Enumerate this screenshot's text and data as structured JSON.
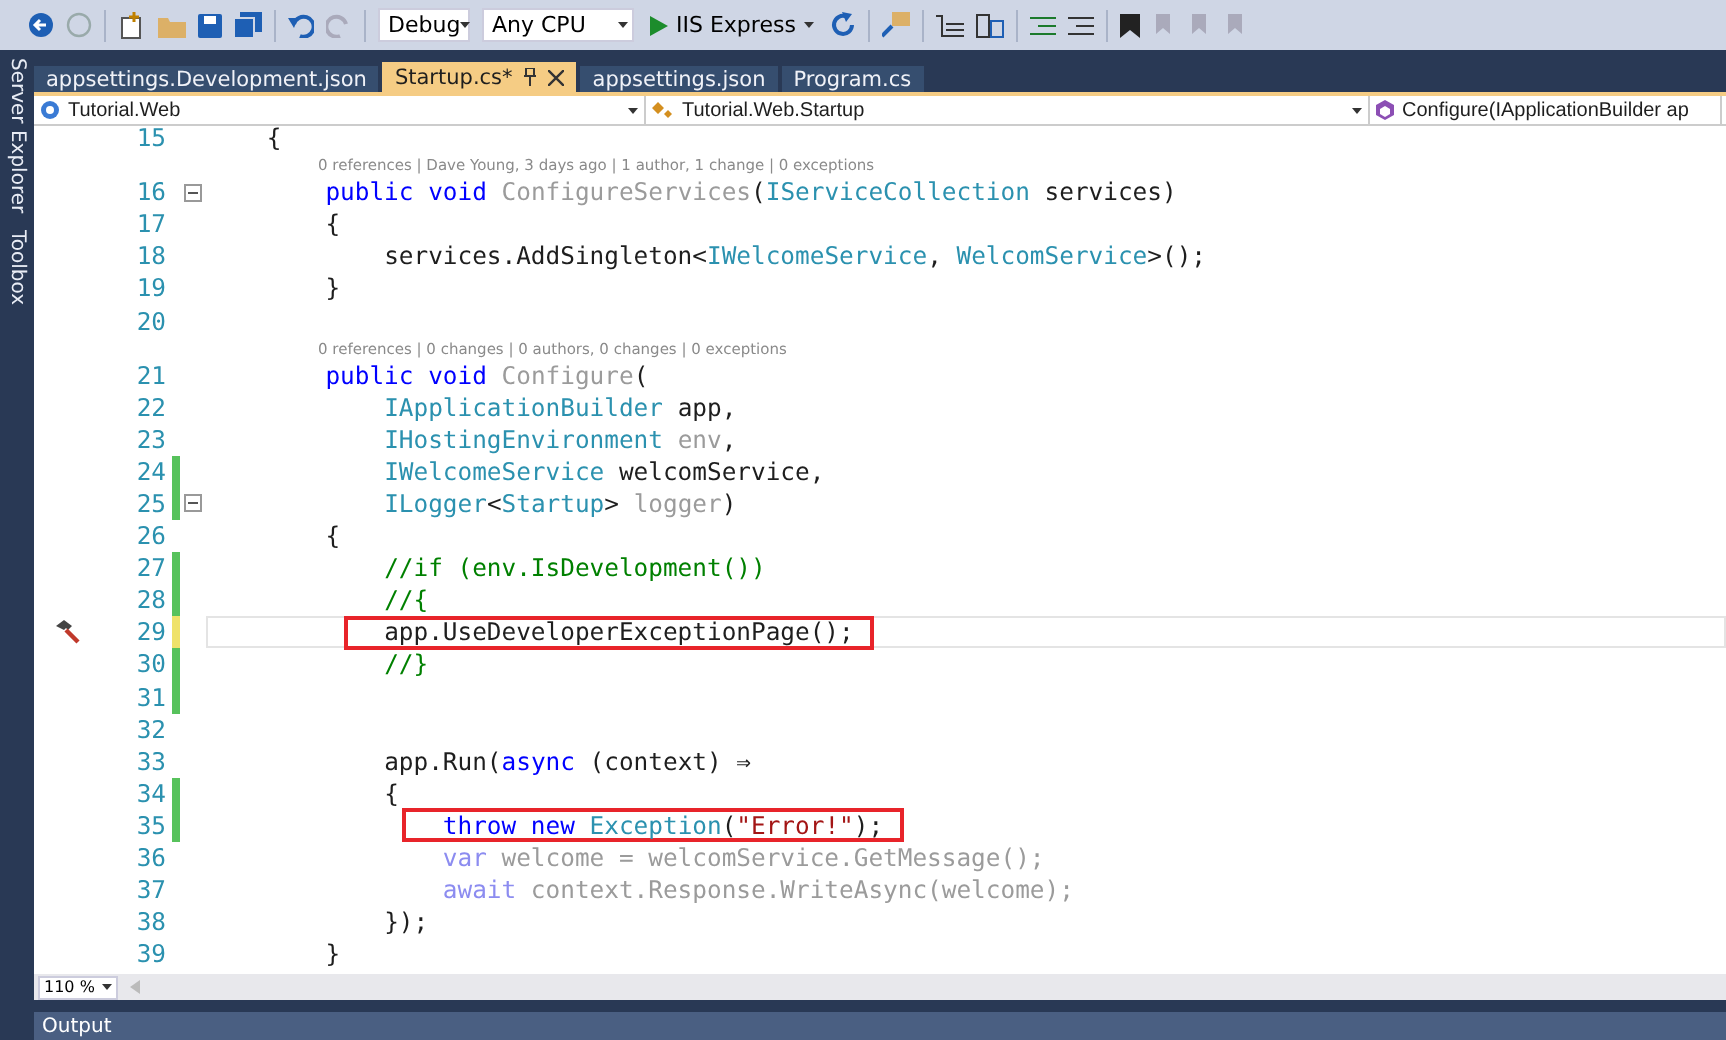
{
  "toolbar": {
    "configuration": "Debug",
    "platform": "Any CPU",
    "run_target": "IIS Express"
  },
  "side_tabs": [
    "Server Explorer",
    "Toolbox"
  ],
  "tabs": [
    {
      "label": "appsettings.Development.json",
      "selected": false
    },
    {
      "label": "Startup.cs*",
      "selected": true
    },
    {
      "label": "appsettings.json",
      "selected": false
    },
    {
      "label": "Program.cs",
      "selected": false
    }
  ],
  "nav": {
    "project": "Tutorial.Web",
    "type": "Tutorial.Web.Startup",
    "member": "Configure(IApplicationBuilder ap"
  },
  "editor": {
    "lines": [
      {
        "number": "15",
        "tokens": [
          {
            "kind": "plain",
            "text": "    {"
          }
        ]
      },
      {
        "codelens": "0 references | Dave Young, 3 days ago | 1 author, 1 change | 0 exceptions",
        "number": "16",
        "fold": true,
        "tokens": [
          {
            "kind": "keyword",
            "text": "        public void "
          },
          {
            "kind": "dim",
            "text": "ConfigureServices"
          },
          {
            "kind": "plain",
            "text": "("
          },
          {
            "kind": "type",
            "text": "IServiceCollection"
          },
          {
            "kind": "plain",
            "text": " services)"
          }
        ]
      },
      {
        "number": "17",
        "tokens": [
          {
            "kind": "plain",
            "text": "        {"
          }
        ]
      },
      {
        "number": "18",
        "tokens": [
          {
            "kind": "plain",
            "text": "            services.AddSingleton<"
          },
          {
            "kind": "type",
            "text": "IWelcomeService"
          },
          {
            "kind": "plain",
            "text": ", "
          },
          {
            "kind": "type",
            "text": "WelcomService"
          },
          {
            "kind": "plain",
            "text": ">();"
          }
        ]
      },
      {
        "number": "19",
        "tokens": [
          {
            "kind": "plain",
            "text": "        }"
          }
        ]
      },
      {
        "number": "20"
      },
      {
        "codelens": "0 references | 0 changes | 0 authors, 0 changes | 0 exceptions",
        "number": "21",
        "tokens": [
          {
            "kind": "keyword",
            "text": "        public void "
          },
          {
            "kind": "dim",
            "text": "Configure"
          },
          {
            "kind": "plain",
            "text": "("
          }
        ]
      },
      {
        "number": "22",
        "tokens": [
          {
            "kind": "type",
            "text": "            IApplicationBuilder"
          },
          {
            "kind": "plain",
            "text": " app,"
          }
        ]
      },
      {
        "number": "23",
        "tokens": [
          {
            "kind": "type",
            "text": "            IHostingEnvironment"
          },
          {
            "kind": "dim",
            "text": " env"
          },
          {
            "kind": "plain",
            "text": ","
          }
        ]
      },
      {
        "number": "24",
        "modified": true,
        "saved": true,
        "tokens": [
          {
            "kind": "type",
            "text": "            IWelcomeService"
          },
          {
            "kind": "plain",
            "text": " welcomService,"
          }
        ]
      },
      {
        "number": "25",
        "modified": true,
        "saved": true,
        "fold": true,
        "tokens": [
          {
            "kind": "type",
            "text": "            ILogger"
          },
          {
            "kind": "plain",
            "text": "<"
          },
          {
            "kind": "type",
            "text": "Startup"
          },
          {
            "kind": "plain",
            "text": ">"
          },
          {
            "kind": "dim",
            "text": " logger"
          },
          {
            "kind": "plain",
            "text": ")"
          }
        ]
      },
      {
        "number": "26",
        "tokens": [
          {
            "kind": "plain",
            "text": "        {"
          }
        ]
      },
      {
        "number": "27",
        "modified": true,
        "saved": true,
        "tokens": [
          {
            "kind": "comment",
            "text": "            //if (env.IsDevelopment())"
          }
        ]
      },
      {
        "number": "28",
        "modified": true,
        "saved": true,
        "tokens": [
          {
            "kind": "comment",
            "text": "            //{"
          }
        ]
      },
      {
        "number": "29",
        "modified": true,
        "saved": false,
        "current": true,
        "quick_action": true,
        "boxed": true,
        "tokens": [
          {
            "kind": "plain",
            "text": "            app.UseDeveloperExceptionPage();"
          }
        ]
      },
      {
        "number": "30",
        "modified": true,
        "saved": true,
        "tokens": [
          {
            "kind": "comment",
            "text": "            //}"
          }
        ]
      },
      {
        "number": "31",
        "modified": true,
        "saved": true
      },
      {
        "number": "32"
      },
      {
        "number": "33",
        "tokens": [
          {
            "kind": "plain",
            "text": "            app.Run("
          },
          {
            "kind": "keyword",
            "text": "async"
          },
          {
            "kind": "plain",
            "text": " (context) ⇒"
          }
        ]
      },
      {
        "number": "34",
        "modified": true,
        "saved": true,
        "tokens": [
          {
            "kind": "plain",
            "text": "            {"
          }
        ]
      },
      {
        "number": "35",
        "modified": true,
        "saved": true,
        "boxed": true,
        "tokens": [
          {
            "kind": "keyword",
            "text": "                throw new"
          },
          {
            "kind": "type",
            "text": " Exception"
          },
          {
            "kind": "plain",
            "text": "("
          },
          {
            "kind": "string",
            "text": "\"Error!\""
          },
          {
            "kind": "plain",
            "text": ");"
          }
        ]
      },
      {
        "number": "36",
        "tokens": [
          {
            "kind": "dim-keyword",
            "text": "                var"
          },
          {
            "kind": "dim",
            "text": " welcome = welcomService.GetMessage();"
          }
        ]
      },
      {
        "number": "37",
        "tokens": [
          {
            "kind": "dim-keyword",
            "text": "                await"
          },
          {
            "kind": "dim",
            "text": " context.Response.WriteAsync(welcome);"
          }
        ]
      },
      {
        "number": "38",
        "tokens": [
          {
            "kind": "plain",
            "text": "            });"
          }
        ]
      },
      {
        "number": "39",
        "tokens": [
          {
            "kind": "plain",
            "text": "        }"
          }
        ]
      }
    ]
  },
  "zoom": "110 %",
  "output_panel": {
    "title": "Output"
  }
}
